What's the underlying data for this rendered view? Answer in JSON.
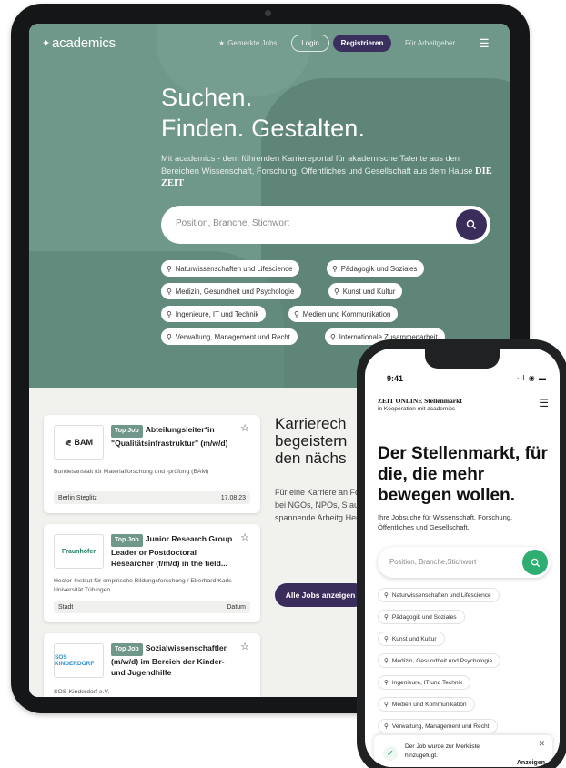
{
  "tablet": {
    "nav": {
      "logo": "academics",
      "saved_jobs": "Gemerkte Jobs",
      "login": "Login",
      "register": "Registrieren",
      "employers": "Für Arbeitgeber"
    },
    "hero": {
      "headline_line1": "Suchen.",
      "headline_line2": "Finden. Gestalten.",
      "intro": "Mit academics - dem führenden Karriereportal für akademische Talente aus den Bereichen Wissenschaft, Forschung, Öffentliches und Gesellschaft aus dem Hause",
      "intro_brand": "DIE ZEIT",
      "search_placeholder": "Position, Branche, Stichwort",
      "chips": [
        "Naturwissenschaften und Lifescience",
        "Pädagogik und Soziales",
        "Medizin, Gesundheit und Psychologie",
        "Kunst und Kultur",
        "Ingenieure, IT und Technik",
        "Medien und Kommunikation",
        "Verwaltung, Management und Recht",
        "Internationale Zusammenarbeit"
      ]
    },
    "jobs": [
      {
        "logo": "BAM",
        "tag": "Top Job",
        "title": "Abteilungsleiter*in \"Qualitätsinfrastruktur\" (m/w/d)",
        "org": "Bundesanstalt für Materialforschung und -prüfung (BAM)",
        "location": "Berlin Steglitz",
        "date": "17.08.23"
      },
      {
        "logo": "Fraunhofer",
        "tag": "Top Job",
        "title": "Junior Research Group Leader or Postdoctoral Researcher (f/m/d) in the field...",
        "org": "Hector-Institut für empirische Bildungsforschung / Eberhard Karls Universität Tübingen",
        "location": "Stadt",
        "date": "Datum"
      },
      {
        "logo": "SOS KINDERDORF",
        "tag": "Top Job",
        "title": "Sozialwissenschaftler (m/w/d) im Bereich der Kinder- und Jugendhilfe",
        "org": "SOS-Kinderdorf e.V."
      }
    ],
    "side": {
      "title_l1": "Karrierech",
      "title_l2": "begeistern",
      "title_l3": "den nächs",
      "text": "Für eine Karriere an Forschungseinrichtungen, bei NGOs, NPOs, S auch privaten Schu spannende Arbeitg Herausforderungen",
      "button": "Alle Jobs anzeigen"
    }
  },
  "phone": {
    "time": "9:41",
    "status": "·ıl ◉ ▬",
    "brand": "ZEIT ONLINE Stellenmarkt",
    "brand_sub": "in Kooperation mit academics",
    "headline": "Der Stellenmarkt, für die, die mehr bewegen wollen.",
    "intro": "Ihre Jobsuche für Wissenschaft, Forschung, Öffentliches und Gesellschaft.",
    "search_placeholder": "Position, Branche,Stichwort",
    "chips": [
      "Naturwissenschaften und Lifescience",
      "Pädagogik und Soziales",
      "Kunst und Kultur",
      "Medizin, Gesundheit und Psychologie",
      "Ingenieure, IT und Technik",
      "Medien und Kommunikation",
      "Verwaltung, Management und Recht"
    ],
    "toast": {
      "text": "Der Job wurde zur Merkliste hinzugefügt.",
      "action": "Anzeigen"
    }
  },
  "colors": {
    "hero_green": "#6f978a",
    "brand_purple": "#3a2d5c",
    "search_green": "#2fae72"
  }
}
